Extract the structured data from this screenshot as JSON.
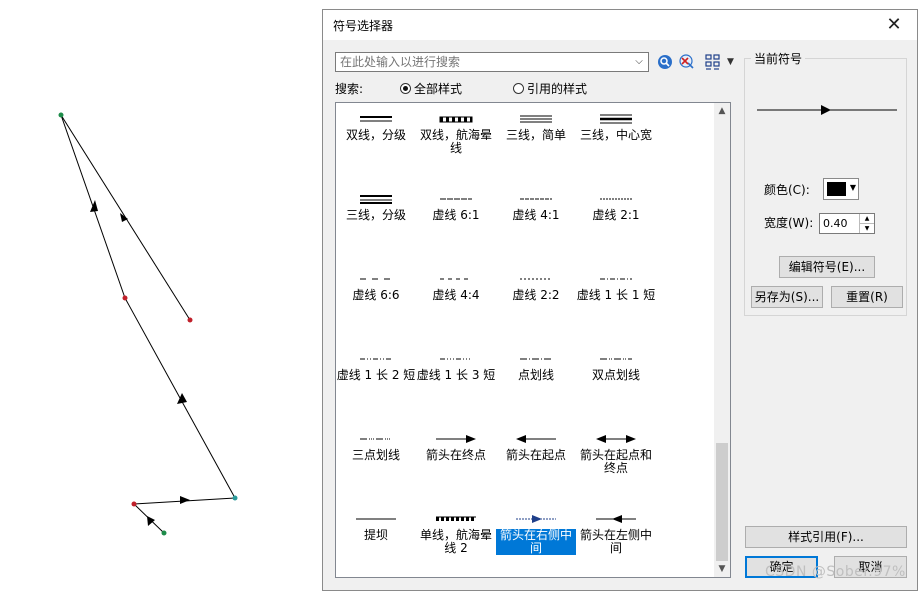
{
  "dialog": {
    "title": "符号选择器",
    "close_glyph": "✕"
  },
  "search": {
    "placeholder": "在此处输入以进行搜索",
    "label": "搜索:",
    "option_all": "全部样式",
    "option_referenced": "引用的样式",
    "selected": "全部样式"
  },
  "symbols": [
    {
      "label": "双线，分级",
      "icon": "double-line-graded"
    },
    {
      "label": "双线，航海晕线",
      "icon": "double-line-nautical"
    },
    {
      "label": "三线，简单",
      "icon": "triple-line-simple"
    },
    {
      "label": "三线，中心宽",
      "icon": "triple-line-center-wide"
    },
    {
      "label": "三线，分级",
      "icon": "triple-line-graded"
    },
    {
      "label": "虚线 6:1",
      "icon": "dash-6-1"
    },
    {
      "label": "虚线 4:1",
      "icon": "dash-4-1"
    },
    {
      "label": "虚线 2:1",
      "icon": "dash-2-1"
    },
    {
      "label": "虚线 6:6",
      "icon": "dash-6-6"
    },
    {
      "label": "虚线 4:4",
      "icon": "dash-4-4"
    },
    {
      "label": "虚线 2:2",
      "icon": "dash-2-2"
    },
    {
      "label": "虚线 1 长 1 短",
      "icon": "dash-long-short"
    },
    {
      "label": "虚线 1 长 2 短",
      "icon": "dash-long-2-short"
    },
    {
      "label": "虚线 1 长 3 短",
      "icon": "dash-long-3-short"
    },
    {
      "label": "点划线",
      "icon": "dash-dot"
    },
    {
      "label": "双点划线",
      "icon": "dash-double-dot"
    },
    {
      "label": "三点划线",
      "icon": "dash-triple-dot"
    },
    {
      "label": "箭头在终点",
      "icon": "arrow-at-end"
    },
    {
      "label": "箭头在起点",
      "icon": "arrow-at-start"
    },
    {
      "label": "箭头在起点和终点",
      "icon": "arrow-both-ends"
    },
    {
      "label": "提坝",
      "icon": "levee"
    },
    {
      "label": "单线，航海晕线 2",
      "icon": "single-line-nautical"
    },
    {
      "label": "箭头在右侧中间",
      "icon": "arrow-middle-right",
      "selected": true
    },
    {
      "label": "箭头在左侧中间",
      "icon": "arrow-middle-left"
    }
  ],
  "current_symbol": {
    "caption": "当前符号",
    "color_label": "颜色(C):",
    "color": "#000000",
    "width_label": "宽度(W):",
    "width_value": "0.40",
    "edit_button": "编辑符号(E)...",
    "save_as_button": "另存为(S)...",
    "reset_button": "重置(R)"
  },
  "footer": {
    "style_ref_button": "样式引用(F)...",
    "ok_button": "确定",
    "cancel_button": "取消"
  },
  "watermark": "CSDN @Sober.97%",
  "colors": {
    "selection": "#0078d7",
    "vertex_green": "#1e8c4a",
    "vertex_red": "#c0202a",
    "vertex_teal": "#2a9a9a"
  }
}
